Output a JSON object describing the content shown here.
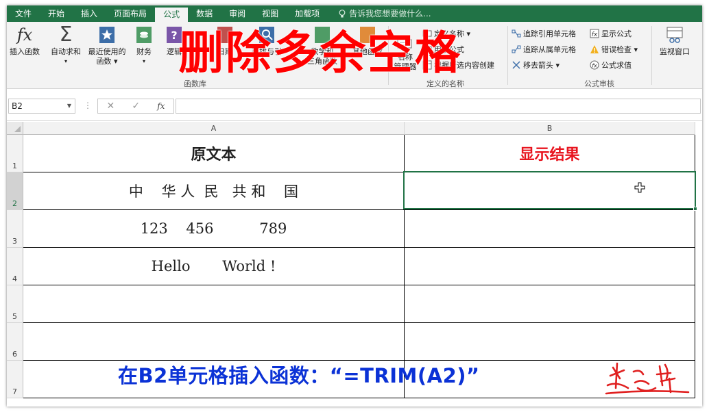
{
  "ribbon_tabs": [
    "文件",
    "开始",
    "插入",
    "页面布局",
    "公式",
    "数据",
    "审阅",
    "视图",
    "加载项"
  ],
  "tell_me": "告诉我您想要做什么...",
  "ribbon": {
    "insert_function": "插入函数",
    "autosum": "自动求和",
    "recent_used": "最近使用的",
    "recent_used_2": "函数",
    "financial": "财务",
    "logical": "逻辑",
    "date_time": "日期",
    "lookup": "查找与引",
    "math": "数学和",
    "math_2": "三角函数",
    "other": "其他函数",
    "group_function_library": "函数库",
    "name_manager": "名称",
    "name_manager_2": "管理器",
    "define_name": "定义名称",
    "use_in_formula": "用于公式",
    "create_from_selection": "根据所选内容创建",
    "group_defined_names": "定义的名称",
    "trace_precedents": "追踪引用单元格",
    "trace_dependents": "追踪从属单元格",
    "remove_arrows": "移去箭头",
    "show_formulas": "显示公式",
    "error_checking": "错误检查",
    "evaluate_formula": "公式求值",
    "group_formula_auditing": "公式审核",
    "watch_window": "监视窗口"
  },
  "overlay_title": "删除多余空格",
  "name_box": "B2",
  "fx_label": "fx",
  "columns": [
    "A",
    "B"
  ],
  "rows": [
    "1",
    "2",
    "3",
    "4",
    "5",
    "6",
    "7"
  ],
  "cells": {
    "a1": "原文本",
    "b1": "显示结果",
    "a2": "中    华 人  民   共 和    国",
    "a3": "123    456          789",
    "a4": "Hello       World !"
  },
  "bottom_caption": "在B2单元格插入函数：“=TRIM(A2)”",
  "colors": {
    "excel_green": "#217346",
    "title_red": "#ff0000",
    "result_header_red": "#e8141e",
    "caption_blue": "#0b32d6"
  }
}
